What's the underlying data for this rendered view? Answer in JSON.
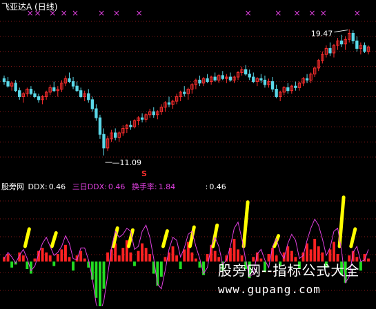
{
  "window": {
    "title": "飞亚达A (日线)"
  },
  "colors": {
    "background": "#000000",
    "up": "#ff2e2e",
    "down": "#5bd8e8",
    "grid": "#8b1a1a",
    "marker": "#e040e0",
    "ddx3": "#e040e0",
    "ddx_pos": "#ff2222",
    "ddx_neg": "#22dd22",
    "turnover": "#ffff00",
    "text": "#ffffff"
  },
  "price_chart": {
    "high_label": "19.47",
    "low_label": "11.09",
    "signal_label": "S",
    "y_range": [
      10.0,
      20.5
    ],
    "gridlines": [
      11.0,
      12.0,
      13.0,
      14.0,
      15.0,
      16.0,
      17.0,
      18.0,
      19.0,
      20.0
    ],
    "marker_glyph": "×"
  },
  "indicator": {
    "name": "股旁网",
    "ddx_label": "DDX:",
    "ddx_value": "0.46",
    "ddx3_label": "三日DDX:",
    "ddx3_value": "0.46",
    "turnover_label": "换手率:",
    "turnover_value": "1.84",
    "extra_label": ":",
    "extra_value": "0.46"
  },
  "watermark": {
    "text": "股旁网--指标公式大全",
    "url": "www.gupang.com"
  },
  "chart_data": {
    "type": "candlestick",
    "ylim": [
      10.0,
      20.5
    ],
    "candles": [
      [
        16.2,
        16.4,
        15.8,
        16.0
      ],
      [
        16.0,
        16.3,
        15.6,
        15.7
      ],
      [
        15.7,
        16.0,
        15.4,
        15.9
      ],
      [
        15.9,
        16.1,
        15.3,
        15.4
      ],
      [
        15.4,
        15.6,
        14.8,
        15.0
      ],
      [
        15.0,
        15.3,
        14.6,
        15.2
      ],
      [
        15.2,
        15.6,
        15.0,
        15.5
      ],
      [
        15.5,
        15.7,
        15.1,
        15.2
      ],
      [
        15.2,
        15.4,
        14.9,
        15.0
      ],
      [
        15.0,
        15.2,
        14.6,
        14.8
      ],
      [
        14.8,
        15.1,
        14.5,
        15.0
      ],
      [
        15.0,
        15.4,
        14.8,
        15.3
      ],
      [
        15.3,
        15.8,
        15.1,
        15.6
      ],
      [
        15.6,
        16.0,
        15.3,
        15.4
      ],
      [
        15.4,
        15.7,
        15.0,
        15.5
      ],
      [
        15.5,
        16.1,
        15.3,
        15.9
      ],
      [
        15.9,
        16.4,
        15.7,
        16.2
      ],
      [
        16.2,
        16.6,
        15.9,
        16.0
      ],
      [
        16.0,
        16.3,
        15.5,
        15.7
      ],
      [
        15.7,
        16.0,
        15.3,
        15.4
      ],
      [
        15.4,
        15.6,
        14.9,
        15.0
      ],
      [
        15.0,
        15.4,
        14.7,
        15.2
      ],
      [
        15.2,
        15.5,
        14.6,
        14.8
      ],
      [
        14.8,
        15.0,
        14.0,
        14.2
      ],
      [
        14.2,
        14.5,
        13.4,
        13.6
      ],
      [
        13.6,
        13.8,
        12.2,
        12.5
      ],
      [
        12.5,
        12.9,
        11.1,
        11.6
      ],
      [
        11.6,
        12.4,
        11.4,
        12.2
      ],
      [
        12.2,
        12.8,
        12.0,
        12.6
      ],
      [
        12.6,
        12.9,
        12.1,
        12.3
      ],
      [
        12.3,
        12.7,
        12.0,
        12.6
      ],
      [
        12.6,
        13.1,
        12.4,
        12.9
      ],
      [
        12.9,
        13.2,
        12.6,
        13.1
      ],
      [
        13.1,
        13.4,
        12.8,
        13.0
      ],
      [
        13.0,
        13.5,
        12.9,
        13.4
      ],
      [
        13.4,
        13.7,
        13.1,
        13.6
      ],
      [
        13.6,
        13.9,
        13.3,
        13.5
      ],
      [
        13.5,
        13.9,
        13.3,
        13.8
      ],
      [
        13.8,
        14.2,
        13.6,
        14.0
      ],
      [
        14.0,
        14.3,
        13.6,
        13.8
      ],
      [
        13.8,
        14.1,
        13.5,
        14.0
      ],
      [
        14.0,
        14.5,
        13.8,
        14.3
      ],
      [
        14.3,
        14.7,
        14.0,
        14.6
      ],
      [
        14.6,
        15.0,
        14.3,
        14.5
      ],
      [
        14.5,
        14.8,
        14.2,
        14.7
      ],
      [
        14.7,
        15.2,
        14.5,
        15.0
      ],
      [
        15.0,
        15.4,
        14.7,
        15.3
      ],
      [
        15.3,
        15.7,
        15.0,
        15.2
      ],
      [
        15.2,
        15.6,
        14.8,
        15.5
      ],
      [
        15.5,
        15.9,
        15.2,
        15.8
      ],
      [
        15.8,
        16.2,
        15.5,
        16.1
      ],
      [
        16.1,
        16.4,
        15.7,
        15.9
      ],
      [
        15.9,
        16.3,
        15.7,
        16.2
      ],
      [
        16.2,
        16.5,
        15.9,
        16.0
      ],
      [
        16.0,
        16.4,
        15.8,
        16.3
      ],
      [
        16.3,
        16.6,
        16.0,
        16.1
      ],
      [
        16.1,
        16.5,
        15.9,
        16.4
      ],
      [
        16.4,
        16.7,
        16.1,
        16.2
      ],
      [
        16.2,
        16.5,
        15.9,
        16.3
      ],
      [
        16.3,
        16.6,
        16.0,
        16.1
      ],
      [
        16.1,
        16.4,
        15.9,
        16.3
      ],
      [
        16.3,
        16.7,
        16.1,
        16.6
      ],
      [
        16.6,
        17.0,
        16.4,
        16.8
      ],
      [
        16.8,
        17.1,
        16.4,
        16.5
      ],
      [
        16.5,
        16.8,
        16.1,
        16.3
      ],
      [
        16.3,
        16.6,
        15.9,
        16.0
      ],
      [
        16.0,
        16.3,
        15.7,
        16.2
      ],
      [
        16.2,
        16.5,
        15.9,
        16.1
      ],
      [
        16.1,
        16.4,
        15.6,
        15.8
      ],
      [
        15.8,
        16.2,
        15.6,
        16.0
      ],
      [
        16.0,
        16.3,
        15.3,
        15.5
      ],
      [
        15.5,
        15.8,
        14.9,
        15.0
      ],
      [
        15.0,
        15.4,
        14.7,
        15.3
      ],
      [
        15.3,
        15.7,
        15.1,
        15.6
      ],
      [
        15.6,
        15.9,
        15.2,
        15.4
      ],
      [
        15.4,
        15.8,
        15.2,
        15.7
      ],
      [
        15.7,
        16.0,
        15.4,
        15.6
      ],
      [
        15.6,
        16.0,
        15.4,
        15.9
      ],
      [
        15.9,
        16.3,
        15.7,
        16.2
      ],
      [
        16.2,
        16.5,
        15.9,
        16.1
      ],
      [
        16.1,
        16.6,
        15.9,
        16.5
      ],
      [
        16.5,
        17.0,
        16.3,
        16.9
      ],
      [
        16.9,
        17.5,
        16.7,
        17.4
      ],
      [
        17.4,
        18.0,
        17.2,
        17.8
      ],
      [
        17.8,
        18.4,
        17.6,
        18.2
      ],
      [
        18.2,
        18.6,
        17.7,
        17.9
      ],
      [
        17.9,
        18.5,
        17.6,
        18.4
      ],
      [
        18.4,
        18.9,
        18.1,
        18.7
      ],
      [
        18.7,
        19.1,
        18.3,
        18.5
      ],
      [
        18.5,
        19.0,
        18.1,
        18.8
      ],
      [
        18.8,
        19.47,
        18.6,
        19.2
      ],
      [
        19.2,
        19.4,
        18.5,
        18.7
      ],
      [
        18.7,
        19.0,
        18.0,
        18.2
      ],
      [
        18.2,
        18.6,
        17.8,
        18.4
      ],
      [
        18.4,
        18.6,
        17.9,
        18.0
      ],
      [
        18.0,
        18.4,
        17.8,
        18.3
      ]
    ],
    "ddx": [
      0.3,
      0.5,
      -0.4,
      -0.2,
      0.6,
      0.4,
      -0.5,
      -0.8,
      0.2,
      0.7,
      0.9,
      0.6,
      0.4,
      -0.3,
      0.5,
      0.8,
      1.1,
      0.3,
      -0.6,
      0.4,
      0.7,
      0.2,
      -0.4,
      -1.2,
      -2.4,
      -3.0,
      -1.8,
      0.6,
      0.8,
      1.2,
      0.4,
      0.9,
      1.4,
      0.6,
      -0.3,
      0.7,
      1.2,
      0.9,
      0.5,
      -0.8,
      -1.6,
      -1.0,
      0.3,
      0.6,
      1.0,
      0.4,
      -0.5,
      0.8,
      1.3,
      0.6,
      0.2,
      -0.4,
      -0.9,
      0.5,
      1.1,
      0.7,
      0.3,
      -0.6,
      0.4,
      0.9,
      1.5,
      0.8,
      0.4,
      -0.5,
      -1.1,
      0.3,
      0.6,
      0.2,
      -0.7,
      0.5,
      0.9,
      0.4,
      -0.3,
      0.6,
      1.0,
      0.7,
      0.3,
      -0.5,
      0.6,
      1.2,
      0.8,
      1.5,
      1.0,
      0.6,
      -0.4,
      0.8,
      1.3,
      0.5,
      -0.9,
      -1.4,
      0.4,
      0.7,
      0.3,
      -0.6,
      0.5,
      0.2
    ],
    "ddx3": [
      0.2,
      0.6,
      0.3,
      -0.1,
      0.4,
      0.8,
      0.2,
      -0.6,
      -0.3,
      0.5,
      1.2,
      1.6,
      1.0,
      0.4,
      0.6,
      1.0,
      1.7,
      1.2,
      0.2,
      0.1,
      0.9,
      0.9,
      0.1,
      -1.1,
      -2.8,
      -3.4,
      -2.6,
      -0.9,
      0.9,
      2.0,
      1.6,
      1.8,
      2.2,
      2.0,
      0.8,
      1.0,
      2.0,
      2.4,
      1.6,
      0.2,
      -1.5,
      -1.8,
      -0.6,
      0.8,
      1.6,
      1.4,
      0.3,
      0.9,
      1.8,
      2.0,
      1.0,
      0.2,
      -0.8,
      -0.4,
      1.0,
      1.6,
      1.0,
      -0.2,
      0.1,
      1.0,
      2.2,
      2.6,
      1.5,
      0.1,
      -1.0,
      -0.8,
      0.5,
      0.8,
      0.1,
      -0.4,
      1.0,
      1.5,
      0.6,
      0.2,
      1.2,
      1.8,
      1.4,
      0.2,
      0.4,
      1.4,
      2.2,
      2.8,
      2.4,
      1.5,
      0.4,
      0.9,
      2.0,
      2.2,
      0.7,
      -1.4,
      -1.0,
      0.6,
      1.0,
      0.0,
      0.1,
      0.8
    ],
    "turnover": [
      0,
      0,
      0,
      0,
      0,
      0,
      1.8,
      0,
      0,
      0,
      0,
      0,
      0,
      1.4,
      0,
      0,
      0,
      0,
      0,
      0,
      0,
      0,
      0,
      0,
      0,
      0,
      0,
      0,
      0,
      1.9,
      0,
      0,
      0,
      1.7,
      0,
      0,
      0,
      0,
      0,
      0,
      0,
      0,
      1.6,
      0,
      0,
      0,
      0,
      0,
      0,
      2.0,
      0,
      0,
      0,
      0,
      0,
      2.2,
      0,
      0,
      0,
      0,
      0,
      0,
      0,
      4.6,
      0,
      0,
      0,
      0,
      0,
      0,
      0,
      1.1,
      0,
      0,
      0,
      0,
      0,
      0,
      0,
      0,
      0,
      0,
      0,
      0,
      0,
      0,
      0,
      0,
      5.1,
      0,
      0,
      1.8,
      0,
      0,
      0,
      0
    ],
    "markers": [
      0.08,
      0.1,
      0.14,
      0.17,
      0.2,
      0.27,
      0.31,
      0.37,
      0.66,
      0.74,
      0.79,
      0.83,
      0.86,
      0.95
    ]
  }
}
